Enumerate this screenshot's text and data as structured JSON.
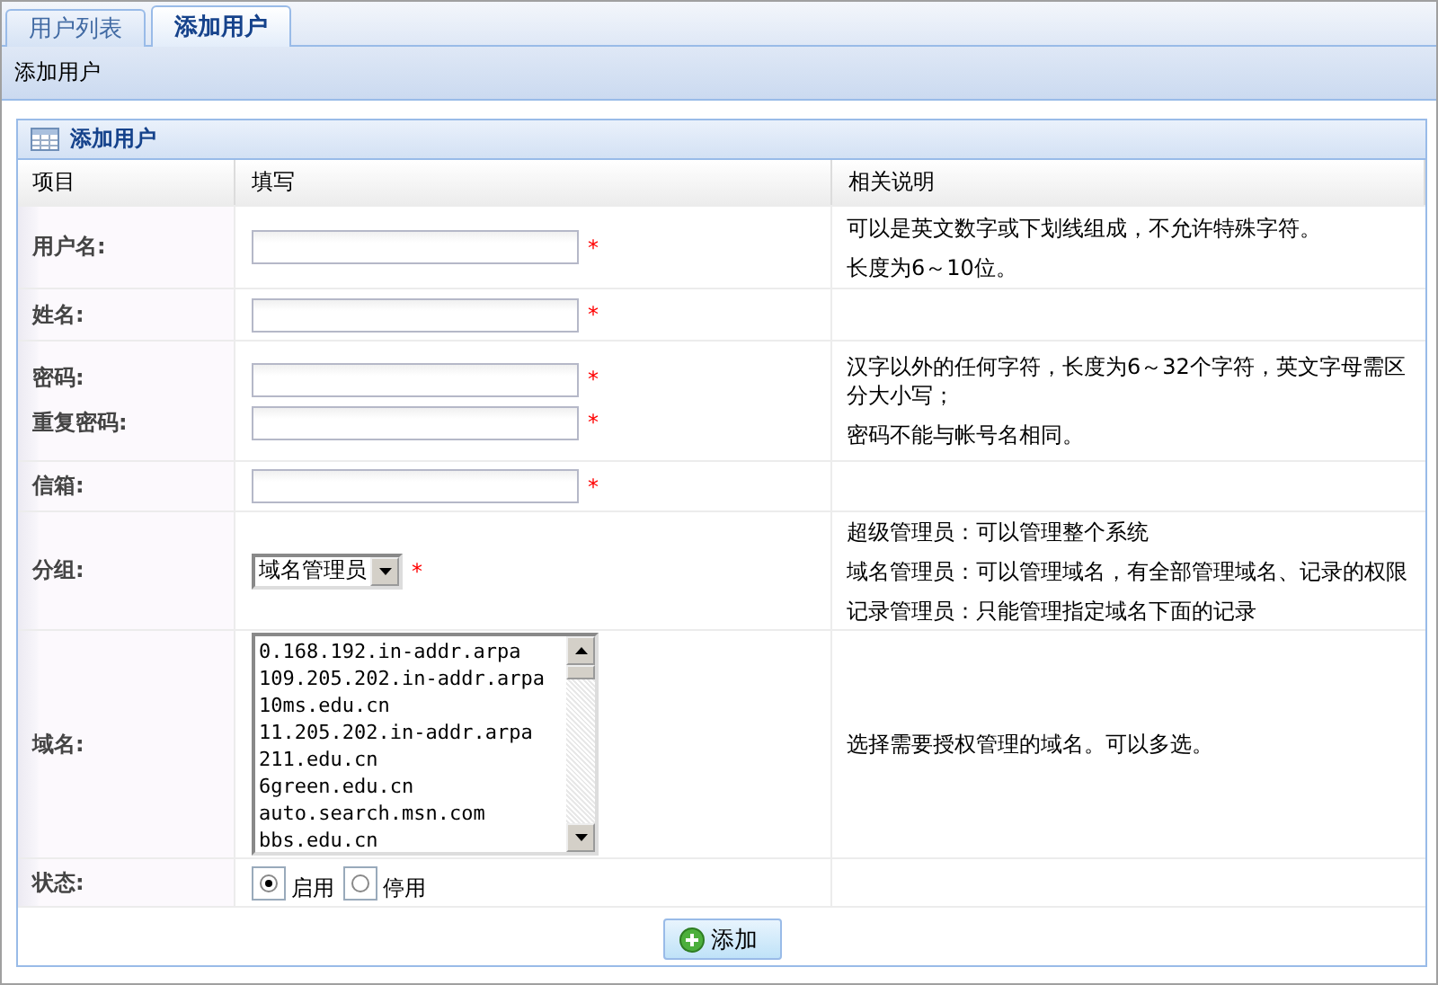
{
  "tabs": [
    {
      "label": "用户列表",
      "selected": false
    },
    {
      "label": "添加用户",
      "selected": true
    }
  ],
  "breadcrumb": "添加用户",
  "panel": {
    "title": "添加用户",
    "columns": [
      "项目",
      "填写",
      "相关说明"
    ],
    "rows": [
      {
        "kind": "text",
        "labels": [
          "用户名:"
        ],
        "fields": [
          {
            "mark": "*"
          }
        ],
        "notes": [
          "可以是英文数字或下划线组成，不允许特殊字符。",
          "长度为6～10位。"
        ]
      },
      {
        "kind": "text",
        "labels": [
          "姓名:"
        ],
        "fields": [
          {
            "mark": "*"
          }
        ]
      },
      {
        "kind": "text",
        "labels": [
          "密码:",
          "重复密码:"
        ],
        "fields": [
          {
            "mark": "*"
          },
          {
            "mark": "*"
          }
        ],
        "notes": [
          "汉字以外的任何字符，长度为6～32个字符，英文字母需区分大小写；",
          "密码不能与帐号名相同。"
        ]
      },
      {
        "kind": "text",
        "labels": [
          "信箱:"
        ],
        "fields": [
          {
            "mark": "*"
          }
        ]
      },
      {
        "kind": "select",
        "labels": [
          "分组:"
        ],
        "value": "域名管理员",
        "mark": "*",
        "notes": [
          "超级管理员：可以管理整个系统",
          "域名管理员：可以管理域名，有全部管理域名、记录的权限",
          "记录管理员：只能管理指定域名下面的记录"
        ]
      },
      {
        "kind": "listbox",
        "labels": [
          "域名:"
        ],
        "options": [
          "0.168.192.in-addr.arpa",
          "109.205.202.in-addr.arpa",
          "10ms.edu.cn",
          "11.205.202.in-addr.arpa",
          "211.edu.cn",
          "6green.edu.cn",
          "auto.search.msn.com",
          "bbs.edu.cn"
        ],
        "notes": [
          "选择需要授权管理的域名。可以多选。"
        ]
      },
      {
        "kind": "radio",
        "labels": [
          "状态:"
        ],
        "options": [
          {
            "label": "启用",
            "selected": true
          },
          {
            "label": "停用",
            "selected": false
          }
        ]
      }
    ],
    "button": "添加"
  }
}
